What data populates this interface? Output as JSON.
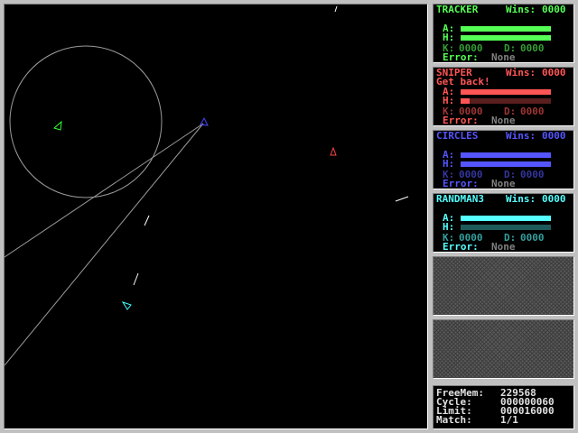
{
  "arena": {
    "robots": [
      {
        "name": "tracker-robot",
        "color": "#33ff33"
      },
      {
        "name": "sniper-robot",
        "color": "#ff4444"
      },
      {
        "name": "circles-robot",
        "color": "#4444ff"
      },
      {
        "name": "randman3-robot",
        "color": "#44ffff"
      }
    ]
  },
  "panels": [
    {
      "name": "TRACKER",
      "wins_label": "Wins:",
      "wins": "0000",
      "color": "#55ff55",
      "message": "",
      "armor_label": "A:",
      "heat_label": "H:",
      "armor": 1.0,
      "heat": 1.0,
      "kills_label": "K:",
      "kills": "0000",
      "deaths_label": "D:",
      "deaths": "0000",
      "error_label": "Error:",
      "error": "None"
    },
    {
      "name": "SNIPER",
      "wins_label": "Wins:",
      "wins": "0000",
      "color": "#ff5555",
      "message": "Get back!",
      "armor_label": "A:",
      "heat_label": "H:",
      "armor": 1.0,
      "heat": 0.1,
      "kills_label": "K:",
      "kills": "0000",
      "deaths_label": "D:",
      "deaths": "0000",
      "error_label": "Error:",
      "error": "None"
    },
    {
      "name": "CIRCLES",
      "wins_label": "Wins:",
      "wins": "0000",
      "color": "#5555ff",
      "message": "",
      "armor_label": "A:",
      "heat_label": "H:",
      "armor": 1.0,
      "heat": 1.0,
      "kills_label": "K:",
      "kills": "0000",
      "deaths_label": "D:",
      "deaths": "0000",
      "error_label": "Error:",
      "error": "None"
    },
    {
      "name": "RANDMAN3",
      "wins_label": "Wins:",
      "wins": "0000",
      "color": "#55ffff",
      "message": "",
      "armor_label": "A:",
      "heat_label": "H:",
      "armor": 1.0,
      "heat": 0.0,
      "kills_label": "K:",
      "kills": "0000",
      "deaths_label": "D:",
      "deaths": "0000",
      "error_label": "Error:",
      "error": "None"
    }
  ],
  "stats": {
    "freemem_label": "FreeMem:",
    "freemem": "229568",
    "cycle_label": "Cycle:",
    "cycle": "000000060",
    "limit_label": "Limit:",
    "limit": "000016000",
    "match_label": "Match:",
    "match": "1/1"
  }
}
